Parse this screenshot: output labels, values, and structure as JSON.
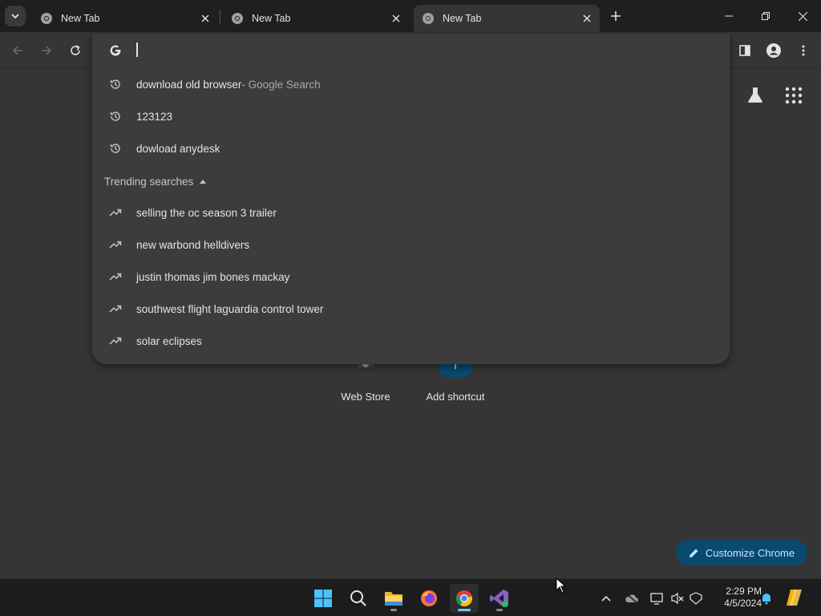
{
  "browser": {
    "tabs": [
      {
        "title": "New Tab",
        "active": false
      },
      {
        "title": "New Tab",
        "active": false
      },
      {
        "title": "New Tab",
        "active": true
      }
    ],
    "window_controls": [
      "minimize",
      "restore",
      "close"
    ]
  },
  "omnibox": {
    "value": "",
    "history": [
      {
        "text": "download old browser",
        "suffix": " - Google Search",
        "icon": "history-icon"
      },
      {
        "text": "123123",
        "suffix": "",
        "icon": "history-icon"
      },
      {
        "text": "dowload anydesk",
        "suffix": "",
        "icon": "history-icon"
      }
    ],
    "trending_header": "Trending searches",
    "trending": [
      {
        "text": "selling the oc season 3 trailer",
        "icon": "trending-icon"
      },
      {
        "text": "new warbond helldivers",
        "icon": "trending-icon"
      },
      {
        "text": "justin thomas jim bones mackay",
        "icon": "trending-icon"
      },
      {
        "text": "southwest flight laguardia control tower",
        "icon": "trending-icon"
      },
      {
        "text": "solar eclipses",
        "icon": "trending-icon"
      }
    ]
  },
  "page": {
    "shortcuts": [
      {
        "label": "Web Store",
        "icon": "chrome-web-store-icon"
      },
      {
        "label": "Add shortcut",
        "icon": "plus-icon"
      }
    ],
    "customize_label": "Customize Chrome"
  },
  "taskbar": {
    "apps": [
      "windows-start-icon",
      "search-icon",
      "file-explorer-icon",
      "firefox-icon",
      "chrome-icon",
      "visual-studio-icon"
    ],
    "time": "2:29 PM",
    "date": "4/5/2024"
  },
  "colors": {
    "tabstrip": "#1f1f1f",
    "page": "#353535",
    "omnibox": "#3c3c3c",
    "accent_button": "#0b4a6f",
    "taskbar": "#1c1c1c"
  }
}
